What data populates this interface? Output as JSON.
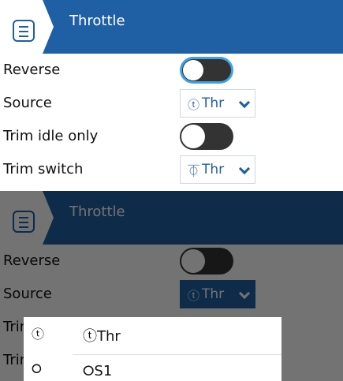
{
  "header": {
    "title": "Throttle",
    "menu_icon": "menu-icon"
  },
  "colors": {
    "header": "#1f5fa3",
    "accent": "#3fa2e6",
    "toggle_off": "#333333",
    "text": "#111111",
    "dim_overlay": "rgba(0,0,0,0.55)"
  },
  "rows": {
    "reverse": {
      "label": "Reverse",
      "value": false
    },
    "source": {
      "label": "Source",
      "icon": "ⓣ",
      "value": "Thr"
    },
    "trim_idle_only": {
      "label": "Trim idle only",
      "value": false
    },
    "trim_switch": {
      "label": "Trim switch",
      "icon": "⏁",
      "value": "Thr"
    }
  },
  "popup": {
    "options": [
      {
        "icon": "ⓣ",
        "label": "ⓣThr"
      },
      {
        "icon": "⭘",
        "label": "⭘S1"
      }
    ]
  }
}
